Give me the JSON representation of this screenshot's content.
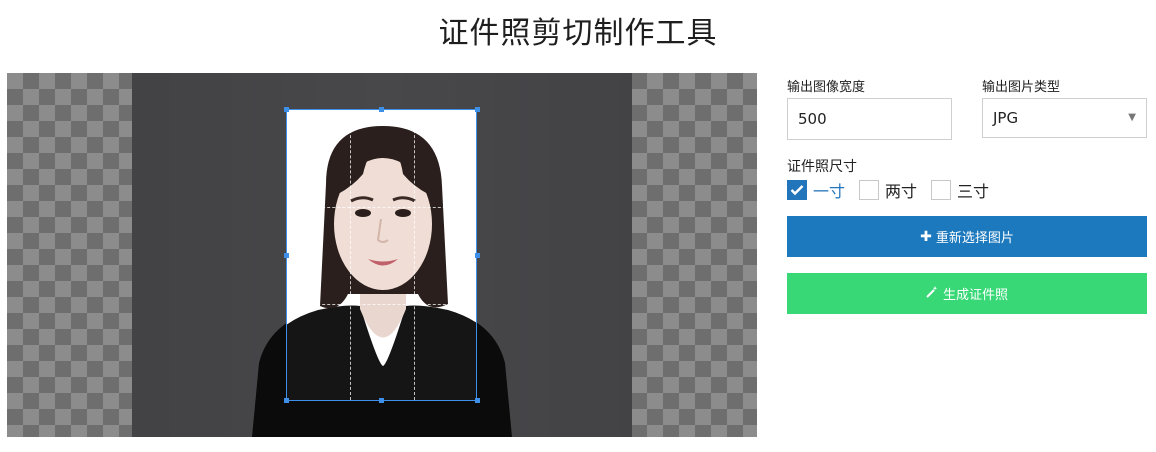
{
  "page": {
    "title": "证件照剪切制作工具"
  },
  "form": {
    "width_label": "输出图像宽度",
    "width_value": "500",
    "type_label": "输出图片类型",
    "type_value": "JPG",
    "size_label": "证件照尺寸",
    "size_options": [
      {
        "label": "一寸",
        "checked": true
      },
      {
        "label": "两寸",
        "checked": false
      },
      {
        "label": "三寸",
        "checked": false
      }
    ]
  },
  "buttons": {
    "reselect": {
      "icon": "plus-icon",
      "label": "重新选择图片",
      "color": "#1c79bd"
    },
    "generate": {
      "icon": "magic-wand-icon",
      "label": "生成证件照",
      "color": "#38d877"
    }
  },
  "colors": {
    "accent": "#2375bb",
    "crop_border": "#3d8fe8"
  }
}
